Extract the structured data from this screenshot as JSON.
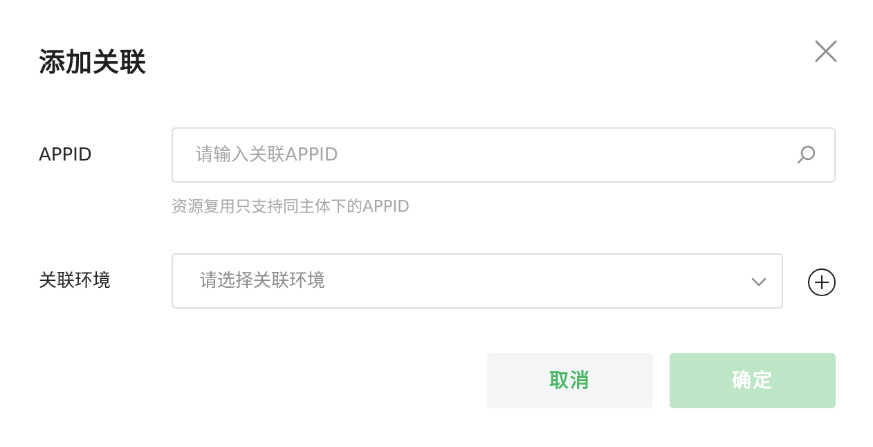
{
  "dialog": {
    "title": "添加关联"
  },
  "appid": {
    "label": "APPID",
    "placeholder": "请输入关联APPID",
    "value": "",
    "hint": "资源复用只支持同主体下的APPID",
    "icon": "search-icon"
  },
  "environment": {
    "label": "关联环境",
    "placeholder": "请选择关联环境",
    "icon": "chevron-down-icon",
    "add_icon": "plus-circle-icon"
  },
  "actions": {
    "cancel_label": "取消",
    "ok_label": "确定"
  },
  "colors": {
    "accent": "#4cb766",
    "primary_disabled": "#bde6c6",
    "secondary_bg": "#f4f5f7",
    "border": "#dedede",
    "placeholder": "#a6a6a6"
  }
}
